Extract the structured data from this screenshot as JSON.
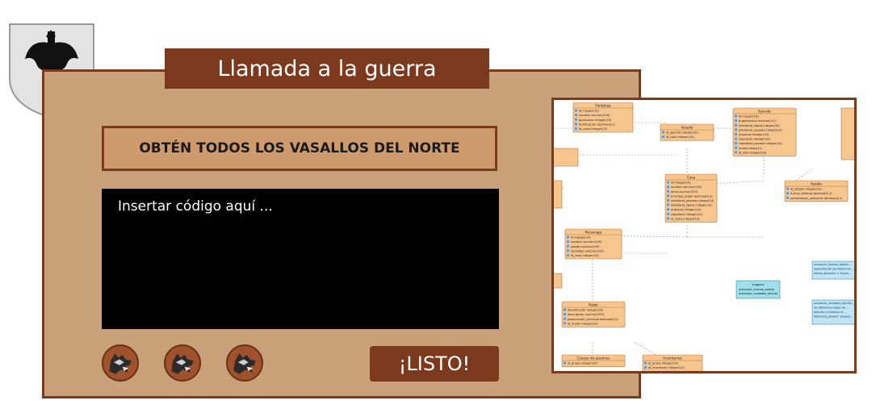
{
  "title": "Llamada a la guerra",
  "mission": "OBTÉN TODOS LOS VASALLOS DEL NORTE",
  "editor": {
    "placeholder": "Insertar código aquí ..."
  },
  "lives": [
    {
      "icon": "wolf-sigil-icon"
    },
    {
      "icon": "wolf-sigil-icon"
    },
    {
      "icon": "wolf-sigil-icon"
    }
  ],
  "ready_label": "¡LISTO!",
  "emblem": {
    "icon": "battle-axe-shield-icon"
  },
  "diagram": {
    "tables": [
      {
        "name": "Fortaleza",
        "rows": [
          "id  integer(10)",
          "nombre  varchar(255)",
          "guarnicion  integer(10)",
          "fortificacion  decimal(5,2)",
          "id_reino  integer(10)"
        ]
      },
      {
        "name": "Vasallo",
        "rows": [
          "id_ejercito  integer(10)",
          "id_casa  integer(10)"
        ]
      },
      {
        "name": "Ejercito",
        "rows": [
          "id  integer(10)",
          "organizacion  decimal(4,2)",
          "infanteria_ligera  integer(10)",
          "infanteria_pesada  integer(10)",
          "arqueros  integer(10)",
          "caballeria  integer(10)",
          "caballeria_pesada  integer(10)",
          "armas  binary(1)",
          "id_lider  integer(10)"
        ]
      },
      {
        "name": "Casa",
        "rows": [
          "id  integer(10)",
          "nombre  varchar(255)",
          "lema  varchar(255)",
          "principal_poder  decimal(4,2)",
          "infanteria_pesada  integer(10)",
          "infanteria_ligera  integer(10)",
          "arqueros  integer(10)",
          "caballeria  integer(10)",
          "id_reino  integer(10)"
        ]
      },
      {
        "name": "Asedio",
        "rows": [
          "id_batalla  integer(10)",
          "turnos_defensa  decimal(4,2)",
          "penalizacion_atacante  decimal(4,2)"
        ]
      },
      {
        "name": "Personaje",
        "rows": [
          "id  integer(10)",
          "nombre  varchar(255)",
          "apodo  varchar(255)",
          "habilidad  varchar(255)",
          "id_casa  integer(10)"
        ]
      },
      {
        "name": "Poder",
        "rows": [
          "identificador  integer(10)",
          "descripcion  varchar(255)",
          "potenciador_principal  decimal(4,2)",
          "id_dueño  integer(10)"
        ]
      },
      {
        "name": "Cuerpo de asesinos",
        "rows": [
          "id_grupo  integer(10)"
        ]
      },
      {
        "name": "Inventarios",
        "rows": [
          "id_grupo  integer(10)",
          "id_inventario  integer(10)"
        ]
      }
    ],
    "triggers": {
      "name": "triggers",
      "rows": [
        "actualizar_fuerzas_batalla",
        "actualizar_unidades_ejercito"
      ]
    },
    "notes": [
      [
        "actualizar_fuerzas_batalla ...",
        "dependiendo del diferencial ...",
        "fuerza_atacante' y 'fuerza_..."
      ],
      [
        "actualizar_unidades_ejercito ...",
        "las diferentes tropas de ...",
        "ejercito a introducir el ...",
        "infanteria_pesada' 'arquero..."
      ]
    ]
  }
}
